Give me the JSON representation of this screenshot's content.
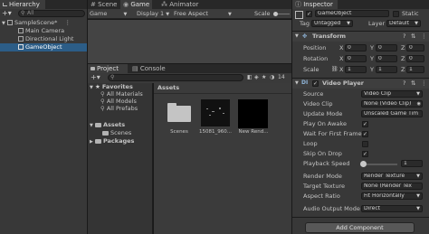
{
  "hierarchy": {
    "tab": "Hierarchy",
    "search_placeholder": "All",
    "items": [
      {
        "label": "SampleScene*"
      },
      {
        "label": "Main Camera"
      },
      {
        "label": "Directional Light"
      },
      {
        "label": "GameObject"
      }
    ]
  },
  "center_tabs": {
    "scene": "Scene",
    "game": "Game",
    "animator": "Animator"
  },
  "game_toolbar": {
    "mode": "Game",
    "display": "Display 1",
    "aspect": "Free Aspect",
    "scale_label": "Scale"
  },
  "project": {
    "tabs": {
      "project": "Project",
      "console": "Console"
    },
    "favorites_label": "Favorites",
    "favorites": [
      "All Materials",
      "All Models",
      "All Prefabs"
    ],
    "assets_label": "Assets",
    "assets_children": [
      "Scenes"
    ],
    "packages_label": "Packages",
    "breadcrumb": "Assets",
    "count": "14",
    "items": [
      {
        "name": "Scenes"
      },
      {
        "name": "15081_960..."
      },
      {
        "name": "New Rend..."
      }
    ]
  },
  "inspector": {
    "tab": "Inspector",
    "static_label": "Static",
    "object_name": "GameObject",
    "tag_label": "Tag",
    "tag_value": "Untagged",
    "layer_label": "Layer",
    "layer_value": "Default",
    "transform": {
      "title": "Transform",
      "rows": [
        {
          "label": "Position",
          "x": "0",
          "y": "0",
          "z": "0"
        },
        {
          "label": "Rotation",
          "x": "0",
          "y": "0",
          "z": "0"
        },
        {
          "label": "Scale",
          "x": "1",
          "y": "1",
          "z": "1"
        }
      ],
      "axis": {
        "x": "X",
        "y": "Y",
        "z": "Z"
      }
    },
    "video_player": {
      "title": "Video Player",
      "source_label": "Source",
      "source_value": "Video Clip",
      "clip_label": "Video Clip",
      "clip_value": "None (Video Clip)",
      "update_label": "Update Mode",
      "update_value": "Unscaled Game Tim",
      "play_on_awake_label": "Play On Awake",
      "wait_first_frame_label": "Wait For First Frame",
      "loop_label": "Loop",
      "skip_on_drop_label": "Skip On Drop",
      "speed_label": "Playback Speed",
      "speed_value": "1",
      "speed_fraction": 0.0,
      "render_mode_label": "Render Mode",
      "render_mode_value": "Render Texture",
      "target_texture_label": "Target Texture",
      "target_texture_value": "None (Render Tex",
      "aspect_label": "Aspect Ratio",
      "aspect_value": "Fit Horizontally",
      "audio_label": "Audio Output Mode",
      "audio_value": "Direct"
    },
    "add_component": "Add Component"
  },
  "colors": {
    "accent": "#2c5d87",
    "bg": "#383838",
    "dark": "#191919"
  }
}
